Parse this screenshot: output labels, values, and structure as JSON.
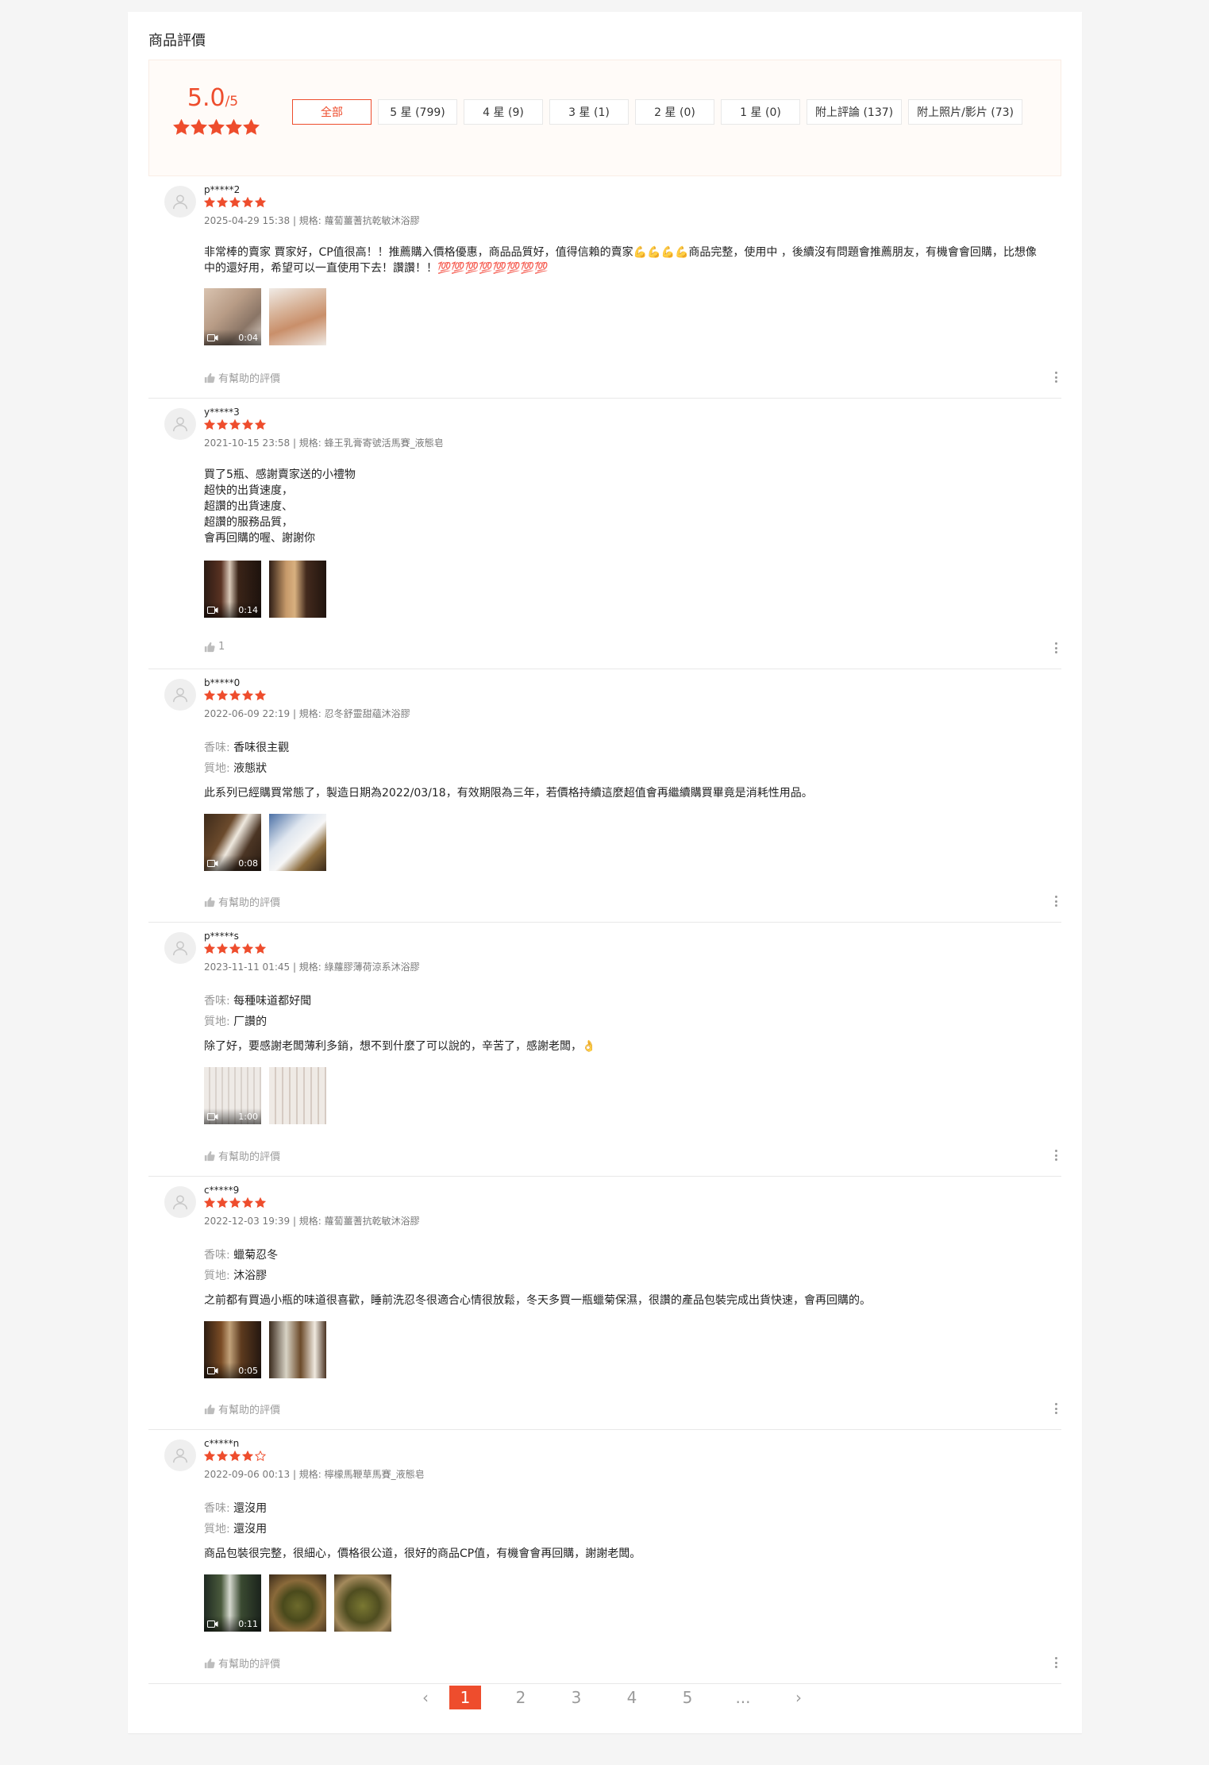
{
  "page_title": "商品評價",
  "summary": {
    "score": "5.0",
    "out_of": "/5",
    "filters": [
      "全部",
      "5 星 (799)",
      "4 星 (9)",
      "3 星 (1)",
      "2 星 (0)",
      "1 星 (0)",
      "附上評論 (137)",
      "附上照片/影片 (73)"
    ],
    "active_filter": "全部"
  },
  "reviews": [
    {
      "user": "p*****2",
      "rating": 5,
      "meta": "2025-04-29 15:38 | 規格: 蘿蔔薑蓍抗乾敏沐浴膠",
      "text": "非常棒的賣家 賈家好，CP值很高！！推薦購入價格優惠，商品品質好，值得信賴的賣家💪💪💪💪商品完整，使用中 ，後續沒有問題會推薦朋友，有機會會回購，比想像中的還好用，希望可以一直使用下去！讚讚！！💯💯💯💯💯💯💯💯",
      "video_duration": "0:04",
      "helpful": "有幫助的評價"
    },
    {
      "user": "y*****3",
      "rating": 5,
      "meta": "2021-10-15 23:58 | 規格: 蜂王乳膏寄號活馬賽_液態皂",
      "text": "買了5瓶、感謝賣家送的小禮物\n超快的出貨速度，\n超讚的出貨速度、\n超讚的服務品質，\n會再回購的喔、謝謝你",
      "video_duration": "0:14",
      "helpful": "1"
    },
    {
      "user": "b*****0",
      "rating": 5,
      "meta": "2022-06-09 22:19 | 規格: 忍冬舒靈甜蘊沐浴膠",
      "attr1_key": "香味:",
      "attr1_val": "香味很主觀",
      "attr2_key": "質地:",
      "attr2_val": "液態狀",
      "text": "此系列已經購買常態了，製造日期為2022/03/18，有效期限為三年，若價格持續這麼超值會再繼續購買畢竟是消耗性用品。",
      "video_duration": "0:08",
      "helpful": "有幫助的評價"
    },
    {
      "user": "p*****s",
      "rating": 5,
      "meta": "2023-11-11 01:45 | 規格: 綠蘿膠薄荷涼系沐浴膠",
      "attr1_key": "香味:",
      "attr1_val": "每種味道都好聞",
      "attr2_key": "質地:",
      "attr2_val": "厂讚的",
      "text": "除了好，要感謝老闆薄利多銷，想不到什麼了可以說的，辛苦了，感謝老闆，👌",
      "video_duration": "1:00",
      "helpful": "有幫助的評價"
    },
    {
      "user": "c*****9",
      "rating": 5,
      "meta": "2022-12-03 19:39 | 規格: 蘿蔔薑蓍抗乾敏沐浴膠",
      "attr1_key": "香味:",
      "attr1_val": "蠟菊忍冬",
      "attr2_key": "質地:",
      "attr2_val": "沐浴膠",
      "text": "之前都有買過小瓶的味道很喜歡，睡前洗忍冬很適合心情很放鬆，冬天多買一瓶蠟菊保濕，很讚的產品包裝完成出貨快速，會再回購的。",
      "video_duration": "0:05",
      "helpful": "有幫助的評價"
    },
    {
      "user": "c*****n",
      "rating": 4,
      "meta": "2022-09-06 00:13 | 規格: 檸檬馬鞭草馬賽_液態皂",
      "attr1_key": "香味:",
      "attr1_val": "還沒用",
      "attr2_key": "質地:",
      "attr2_val": "還沒用",
      "text": "商品包裝很完整，很細心，價格很公道，很好的商品CP值，有機會會再回購，謝謝老闆。",
      "video_duration": "0:11",
      "helpful": "有幫助的評價"
    }
  ],
  "pagination": {
    "prev": "‹",
    "pages": [
      "1",
      "2",
      "3",
      "4",
      "5",
      "..."
    ],
    "active": "1",
    "next": "›"
  },
  "colors": {
    "accent": "#ee4d2d"
  }
}
